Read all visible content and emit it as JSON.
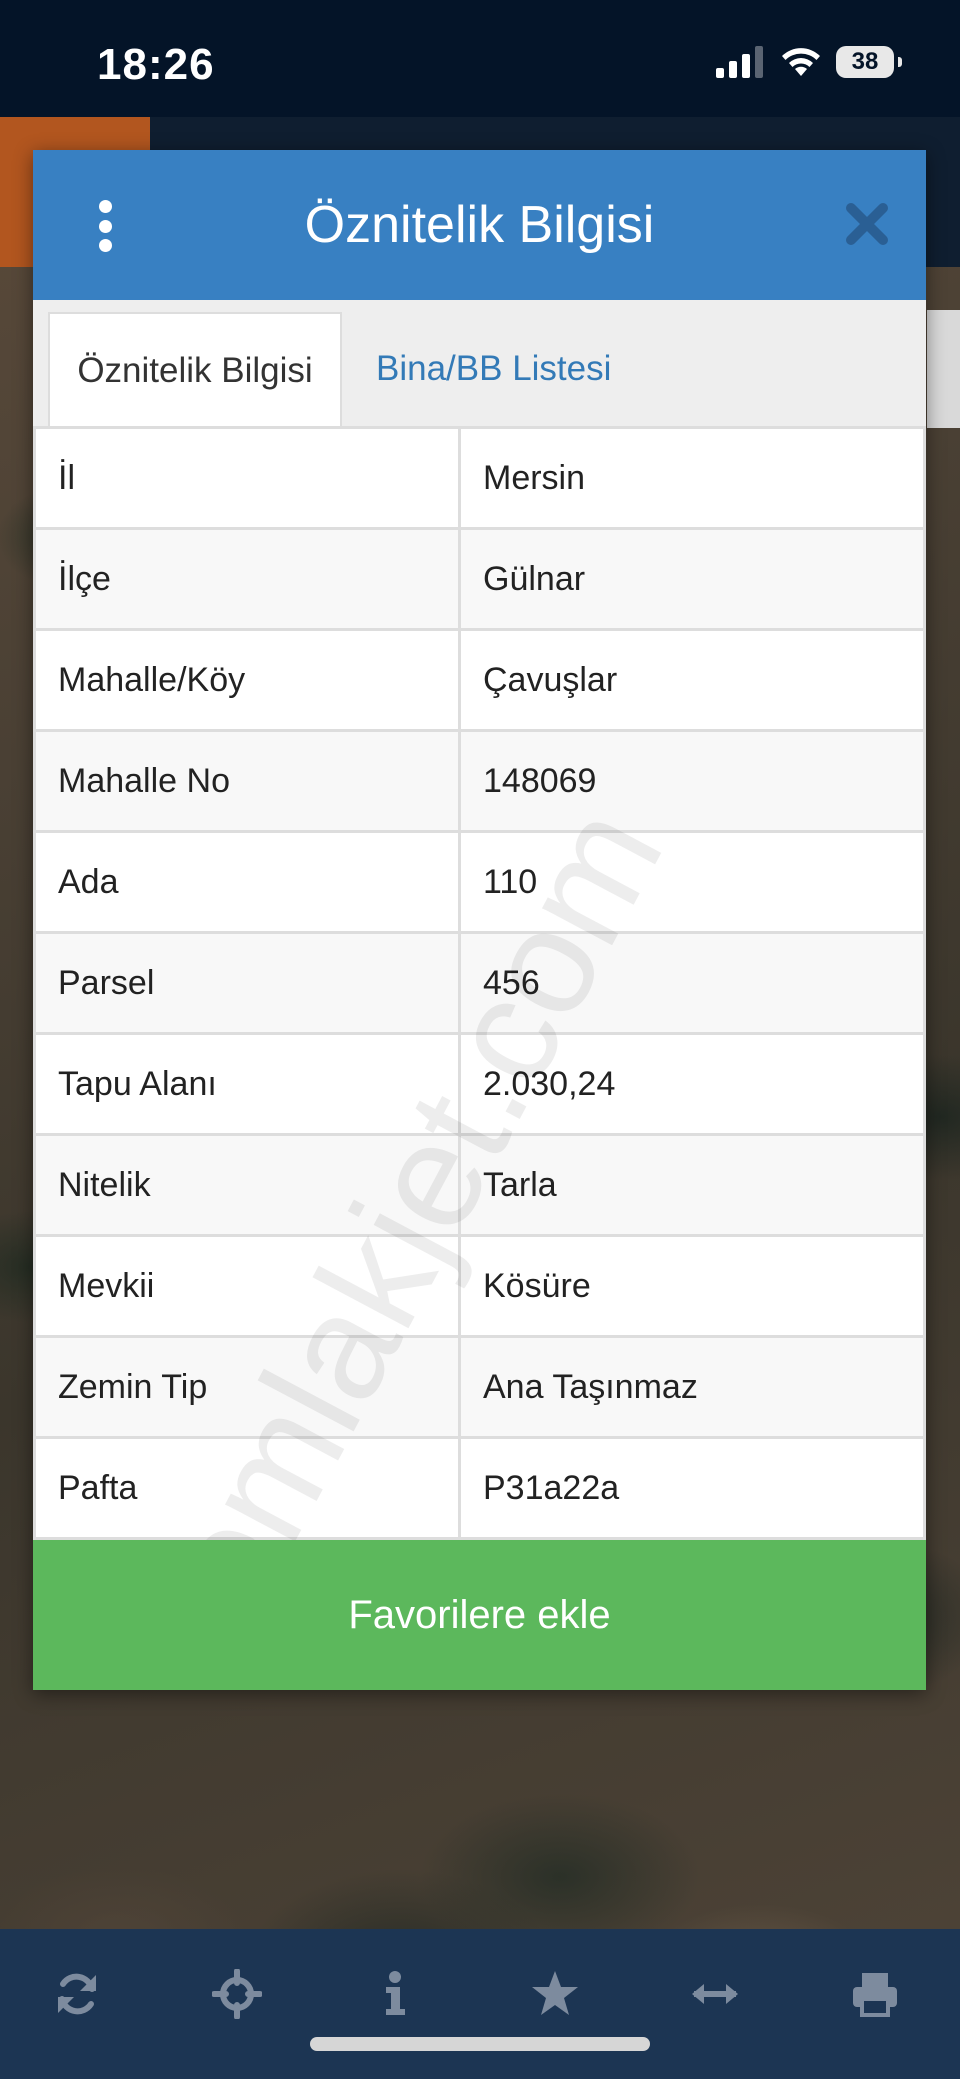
{
  "status_bar": {
    "time": "18:26",
    "battery": "38"
  },
  "modal": {
    "title": "Öznitelik Bilgisi",
    "tabs": [
      {
        "label": "Öznitelik Bilgisi",
        "active": true
      },
      {
        "label": "Bina/BB Listesi",
        "active": false
      }
    ],
    "rows": [
      {
        "key": "İl",
        "value": "Mersin"
      },
      {
        "key": "İlçe",
        "value": "Gülnar"
      },
      {
        "key": "Mahalle/Köy",
        "value": "Çavuşlar"
      },
      {
        "key": "Mahalle No",
        "value": "148069"
      },
      {
        "key": "Ada",
        "value": "110"
      },
      {
        "key": "Parsel",
        "value": "456"
      },
      {
        "key": "Tapu Alanı",
        "value": "2.030,24"
      },
      {
        "key": "Nitelik",
        "value": "Tarla"
      },
      {
        "key": "Mevkii",
        "value": "Kösüre"
      },
      {
        "key": "Zemin Tip",
        "value": "Ana Taşınmaz"
      },
      {
        "key": "Pafta",
        "value": "P31a22a"
      }
    ],
    "favorite_label": "Favorilere ekle",
    "watermark": "emlakjet.com"
  },
  "toolbar": {
    "icons": [
      "refresh-icon",
      "locate-icon",
      "info-icon",
      "star-icon",
      "measure-icon",
      "print-icon"
    ]
  },
  "colors": {
    "header": "#3880c2",
    "favorite": "#5cb85c",
    "toolbar": "#1c3553",
    "tab_link": "#337ab7"
  }
}
